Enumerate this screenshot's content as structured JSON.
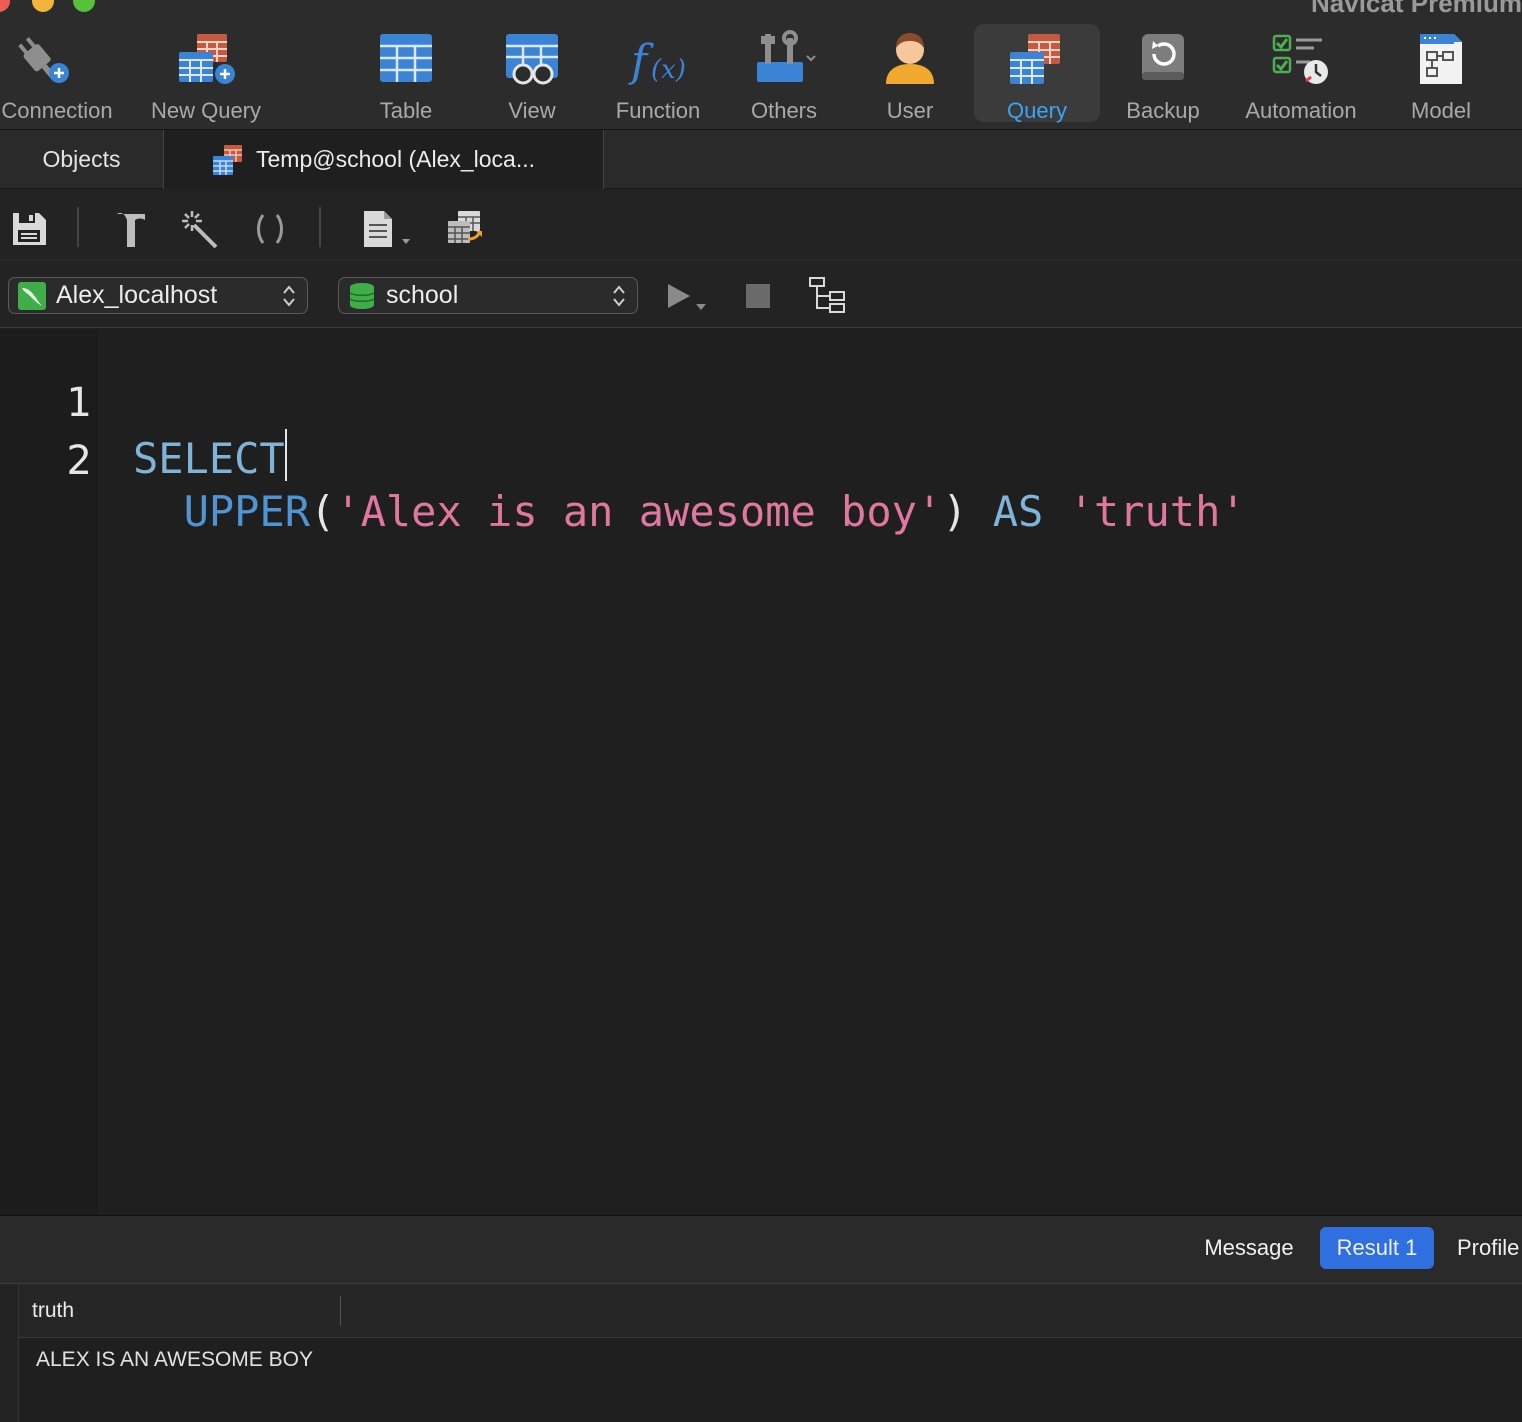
{
  "window": {
    "app_title": "Navicat Premium"
  },
  "toolbar": {
    "buttons": [
      {
        "label": "Connection",
        "icon": "plug-add-icon"
      },
      {
        "label": "New Query",
        "icon": "new-query-icon"
      },
      {
        "label": "Table",
        "icon": "table-icon"
      },
      {
        "label": "View",
        "icon": "view-icon"
      },
      {
        "label": "Function",
        "icon": "function-icon"
      },
      {
        "label": "Others",
        "icon": "tools-icon"
      },
      {
        "label": "User",
        "icon": "user-icon"
      },
      {
        "label": "Query",
        "icon": "query-icon",
        "active": true
      },
      {
        "label": "Backup",
        "icon": "backup-icon"
      },
      {
        "label": "Automation",
        "icon": "automation-icon"
      },
      {
        "label": "Model",
        "icon": "model-icon"
      }
    ]
  },
  "tabs": {
    "objects_label": "Objects",
    "query_tab_label": "Temp@school (Alex_loca..."
  },
  "connection_bar": {
    "connection": "Alex_localhost",
    "database": "school"
  },
  "editor": {
    "lines": [
      {
        "number": "1",
        "tokens": [
          {
            "text": "SELECT",
            "type": "kw"
          }
        ]
      },
      {
        "number": "2",
        "tokens": [
          {
            "text": "  ",
            "type": "punc"
          },
          {
            "text": "UPPER",
            "type": "fn"
          },
          {
            "text": "(",
            "type": "punc"
          },
          {
            "text": "'Alex is an awesome boy'",
            "type": "str"
          },
          {
            "text": ") ",
            "type": "punc"
          },
          {
            "text": "AS",
            "type": "kw"
          },
          {
            "text": " ",
            "type": "punc"
          },
          {
            "text": "'truth'",
            "type": "str"
          }
        ]
      }
    ]
  },
  "result": {
    "tabs": [
      "Message",
      "Result 1",
      "Profile"
    ],
    "active_tab": "Result 1",
    "columns": [
      "truth"
    ],
    "rows": [
      [
        "ALEX IS AN AWESOME BOY"
      ]
    ]
  },
  "colors": {
    "accent": "#3aa4f5",
    "active_result_tab": "#2f6fe0",
    "keyword": "#7fb3d8",
    "function": "#4f95d3",
    "string": "#e0779d"
  }
}
